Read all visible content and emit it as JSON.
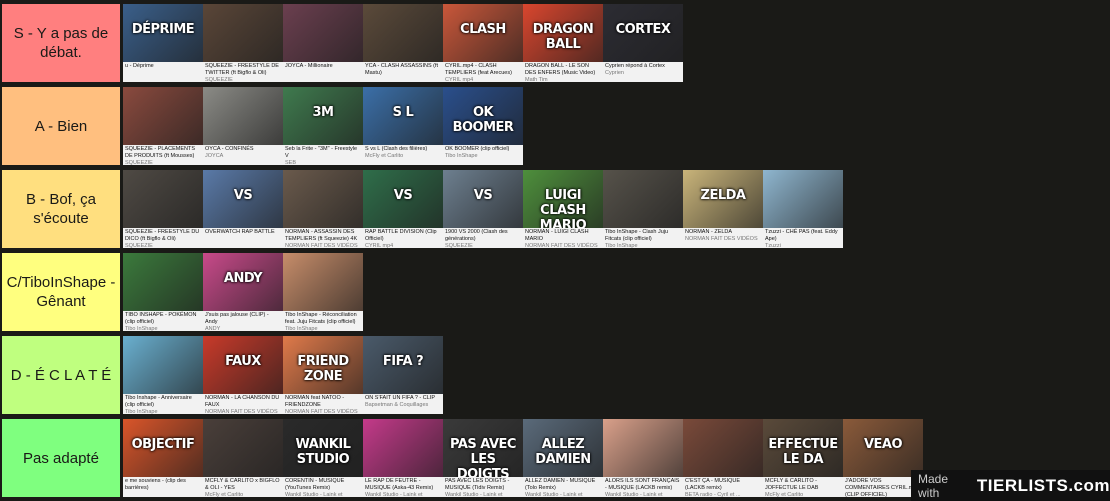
{
  "page": {
    "background": "#1a1a17"
  },
  "tiers": [
    {
      "id": "s",
      "label": "S - Y a pas de débat.",
      "color": "#ff7f7f",
      "items": [
        {
          "overlay": "DÉPRIME",
          "title": "u - Déprime",
          "channel": "",
          "bg": "#3a5f8a"
        },
        {
          "overlay": "",
          "title": "SQUEEZIE - FREESTYLE DE TWITTER (ft Bigflo & Oli)",
          "channel": "SQUEEZIE",
          "bg": "#5a4638"
        },
        {
          "overlay": "",
          "title": "JOYCA - Millionaire",
          "channel": "",
          "bg": "#6b3f4f"
        },
        {
          "overlay": "",
          "title": "YCA - CLASH ASSASSINS (ft Mastu)",
          "channel": "",
          "bg": "#5b4a3a"
        },
        {
          "overlay": "CLASH",
          "title": "CYRIL.mp4 - CLASH TEMPLIERS (feat Arecues)",
          "channel": "CYRIL mp4",
          "bg": "#c9573a"
        },
        {
          "overlay": "DRAGON BALL",
          "title": "DRAGON BALL - LE SON DES ENFERS (Music Video)",
          "channel": "Math Tim",
          "bg": "#d9462e"
        },
        {
          "overlay": "CORTEX",
          "title": "Cyprien répond à Cortex",
          "channel": "Cyprien",
          "bg": "#2c2c33"
        }
      ]
    },
    {
      "id": "a",
      "label": "A - Bien",
      "color": "#ffbf7f",
      "items": [
        {
          "overlay": "",
          "title": "SQUEEZIE - PLACEMENTS DE PRODUITS (ft Mousses)",
          "channel": "SQUEEZIE",
          "bg": "#8a4a3e"
        },
        {
          "overlay": "",
          "title": "OYCA - CONFINÉS",
          "channel": "JOYCA",
          "bg": "#8b8b86"
        },
        {
          "overlay": "3M",
          "title": "Seb la Frite - \"3M\" - Freestyle V",
          "channel": "SEB",
          "bg": "#3f7a4e"
        },
        {
          "overlay": "S L",
          "title": "S vs L (Clash des filières)",
          "channel": "McFly et Carlito",
          "bg": "#3b6fa8"
        },
        {
          "overlay": "OK BOOMER",
          "title": "OK BOOMER (clip officiel)",
          "channel": "Tibo InShape",
          "bg": "#2a4f8c"
        }
      ]
    },
    {
      "id": "b",
      "label": "B - Bof, ça s'écoute",
      "color": "#ffdf7f",
      "items": [
        {
          "overlay": "",
          "title": "SQUEEZIE - FREESTYLE DU DICO (ft Bigflo & Oli)",
          "channel": "SQUEEZIE",
          "bg": "#4f4a44"
        },
        {
          "overlay": "VS",
          "title": "OVERWATCH RAP BATTLE",
          "channel": "",
          "bg": "#5a7aa8"
        },
        {
          "overlay": "",
          "title": "NORMAN - ASSASSIN DES TEMPLIERS (ft Squeezie) 4K",
          "channel": "NORMAN FAIT DES VIDÉOS",
          "bg": "#6a5a4c"
        },
        {
          "overlay": "VS",
          "title": "RAP BATTLE DIVISION (Clip Officiel)",
          "channel": "CYRIL mp4",
          "bg": "#2f6e4a"
        },
        {
          "overlay": "VS",
          "title": "1900 VS 2000 (Clash des générations)",
          "channel": "SQUEEZIE",
          "bg": "#6d7f8f"
        },
        {
          "overlay": "LUIGI CLASH MARIO",
          "title": "NORMAN - LUIGI CLASH MARIO",
          "channel": "NORMAN FAIT DES VIDÉOS",
          "bg": "#4e8f3c"
        },
        {
          "overlay": "",
          "title": "Tibo InShape - Clash Juju Fitcats (clip officiel)",
          "channel": "Tibo InShape",
          "bg": "#56524a"
        },
        {
          "overlay": "ZELDA",
          "title": "NORMAN - ZELDA",
          "channel": "NORMAN FAIT DES VIDÉOS",
          "bg": "#c9b47a"
        },
        {
          "overlay": "",
          "title": "Tzuzzi - CHÉ PAS (feat. Eddy Ape)",
          "channel": "Tzuzzi",
          "bg": "#8fb6cf"
        }
      ]
    },
    {
      "id": "c",
      "label": "C/TiboInShape - Gênant",
      "color": "#ffff7f",
      "items": [
        {
          "overlay": "",
          "title": "TIBO INSHAPE - POKÉMON (clip officiel)",
          "channel": "Tibo InShape",
          "bg": "#3b7a3c"
        },
        {
          "overlay": "ANDY",
          "title": "J'suis pas jalouse (CLIP) - Andy",
          "channel": "ANDY",
          "bg": "#c84a8a"
        },
        {
          "overlay": "",
          "title": "Tibo InShape - Réconciliation feat. Juju Fitcats (clip officiel)",
          "channel": "Tibo InShape",
          "bg": "#c78d6a"
        }
      ]
    },
    {
      "id": "d",
      "label": "D - É C L A T É",
      "color": "#bfff7f",
      "items": [
        {
          "overlay": "",
          "title": "Tibo Inshape - Anniversaire (clip officiel)",
          "channel": "Tibo InShape",
          "bg": "#6ab0d0"
        },
        {
          "overlay": "FAUX",
          "title": "NORMAN - LA CHANSON DU FAUX",
          "channel": "NORMAN FAIT DES VIDÉOS",
          "bg": "#c83a2a"
        },
        {
          "overlay": "FRIEND ZONE",
          "title": "NORMAN feat NATOO - FRIENDZONE",
          "channel": "NORMAN FAIT DES VIDÉOS",
          "bg": "#e07a4a"
        },
        {
          "overlay": "FIFA ?",
          "title": "ON S'FAIT UN FIFA ? - CLIP",
          "channel": "Bapsetman & Coquillages",
          "bg": "#4a5a6a"
        }
      ]
    },
    {
      "id": "na",
      "label": "Pas adapté",
      "color": "#7fff7f",
      "items": [
        {
          "overlay": "OBJECTIF",
          "title": "e me souviens - (clip des barrières)",
          "channel": "",
          "bg": "#d9552a"
        },
        {
          "overlay": "",
          "title": "MCFLY & CARLITO x BIGFLO & OLI - YES",
          "channel": "McFly et Carlito",
          "bg": "#4a3f3a"
        },
        {
          "overlay": "WANKIL STUDIO",
          "title": "CORENTIN - MUSIQUE (YouTunes Remix)",
          "channel": "Wankil Studio - Laink et Terracid",
          "bg": "#2a2a2a"
        },
        {
          "overlay": "",
          "title": "LE RAP DE FEUTRE - MUSIQUE (Aska-43 Remix)",
          "channel": "Wankil Studio - Laink et Terracid",
          "bg": "#c43a8a"
        },
        {
          "overlay": "PAS AVEC LES DOIGTS",
          "title": "PAS AVEC LES DOIGTS - MUSIQUE (Tidiv Remix)",
          "channel": "Wankil Studio - Laink et Terracid",
          "bg": "#3a3a3a"
        },
        {
          "overlay": "ALLEZ DAMIEN",
          "title": "ALLEZ DAMIEN - MUSIQUE (Tolo Remix)",
          "channel": "Wankil Studio - Laink et Terracid",
          "bg": "#5a6a7a"
        },
        {
          "overlay": "",
          "title": "ALORS ILS SONT FRANÇAIS - MUSIQUE (LACKB remix)",
          "channel": "Wankil Studio - Laink et Terracid",
          "bg": "#d9a08a"
        },
        {
          "overlay": "",
          "title": "C'EST ÇA - MUSIQUE (LACKB remix)",
          "channel": "BETA radio - Cyril et ...",
          "bg": "#7a4a3a"
        },
        {
          "overlay": "EFFECTUE LE DA",
          "title": "MCFLY & CARLITO - JOFFECTUE LE DAB",
          "channel": "McFly et Carlito",
          "bg": "#5a4a3a"
        },
        {
          "overlay": "VEAO",
          "title": "J'ADORE VOS COMMENTAIRES CYRIL.mp4 (CLIP OFFICIEL)",
          "channel": "CYRIL mp4",
          "bg": "#8a5a3a"
        }
      ]
    }
  ],
  "watermark": {
    "text": "Made with",
    "brand": "TIERLISTS.com"
  }
}
